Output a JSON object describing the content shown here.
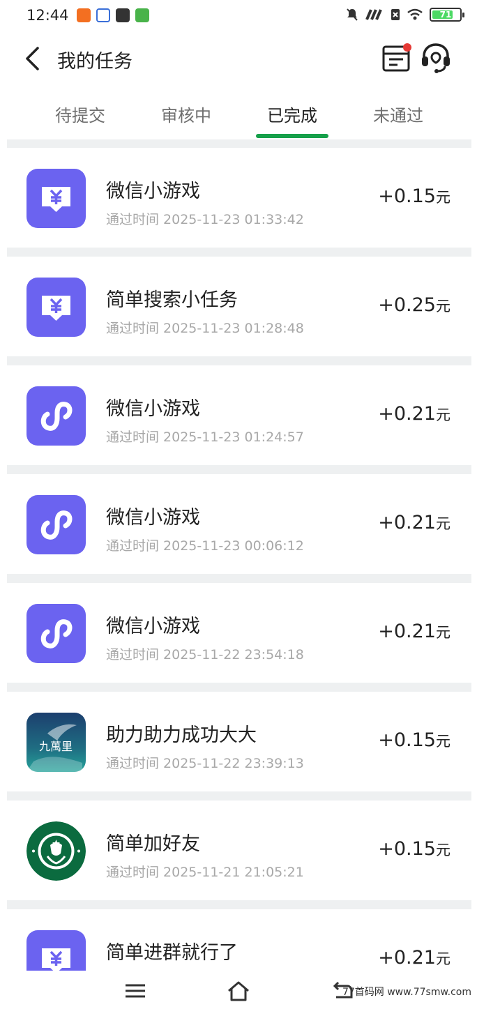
{
  "status_bar": {
    "time": "12:44",
    "battery": "71",
    "left_icons": [
      "app-orange-icon",
      "app-blue-icon",
      "app-dark-icon",
      "app-green-icon"
    ],
    "right_icons": [
      "mute-icon",
      "signal-icon",
      "no-sim-icon",
      "wifi-icon",
      "battery-icon"
    ]
  },
  "header": {
    "title": "我的任务",
    "icons": [
      "back-arrow-icon",
      "order-list-icon",
      "customer-service-icon"
    ]
  },
  "tabs": [
    {
      "label": "待提交",
      "active": false
    },
    {
      "label": "审核中",
      "active": false
    },
    {
      "label": "已完成",
      "active": true
    },
    {
      "label": "未通过",
      "active": false
    }
  ],
  "colors": {
    "accent": "#16a04a",
    "icon_purple": "#6b63f0",
    "background": "#eef0f1",
    "notification_dot": "#e53935"
  },
  "tasks": [
    {
      "title": "微信小游戏",
      "time": "通过时间 2025-11-23 01:33:42",
      "reward": "+0.15",
      "unit": "元",
      "icon": "yuan-chat-icon"
    },
    {
      "title": "简单搜索小任务",
      "time": "通过时间 2025-11-23 01:28:48",
      "reward": "+0.25",
      "unit": "元",
      "icon": "yuan-chat-icon"
    },
    {
      "title": "微信小游戏",
      "time": "通过时间 2025-11-23 01:24:57",
      "reward": "+0.21",
      "unit": "元",
      "icon": "mini-program-icon"
    },
    {
      "title": "微信小游戏",
      "time": "通过时间 2025-11-23 00:06:12",
      "reward": "+0.21",
      "unit": "元",
      "icon": "mini-program-icon"
    },
    {
      "title": "微信小游戏",
      "time": "通过时间 2025-11-22 23:54:18",
      "reward": "+0.21",
      "unit": "元",
      "icon": "mini-program-icon"
    },
    {
      "title": "助力助力成功大大",
      "time": "通过时间 2025-11-22 23:39:13",
      "reward": "+0.15",
      "unit": "元",
      "icon": "jiuwanli-logo-icon",
      "icon_text": "九萬里"
    },
    {
      "title": "简单加好友",
      "time": "通过时间 2025-11-21 21:05:21",
      "reward": "+0.15",
      "unit": "元",
      "icon": "starbucks-logo-icon"
    },
    {
      "title": "简单进群就行了",
      "time": "",
      "reward": "+0.21",
      "unit": "元",
      "icon": "yuan-chat-icon"
    }
  ],
  "nav_bar": {
    "icons": [
      "menu-icon",
      "home-icon",
      "back-icon"
    ]
  },
  "watermark": "77首码网 www.77smw.com"
}
